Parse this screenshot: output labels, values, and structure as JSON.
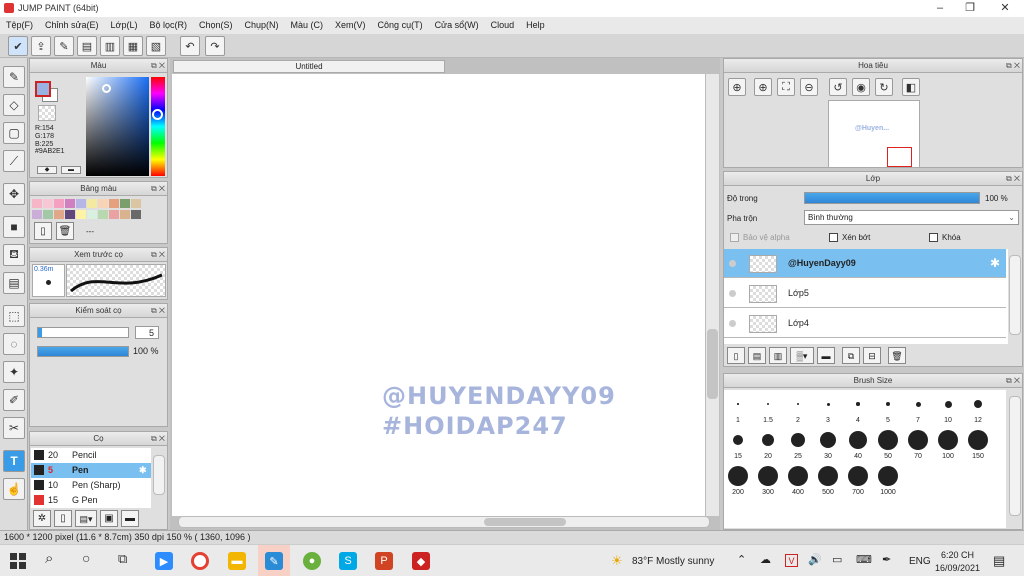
{
  "window": {
    "title": "JUMP PAINT (64bit)",
    "controls": [
      "–",
      "❐",
      "✕"
    ]
  },
  "menu": [
    "Tệp(F)",
    "Chỉnh sửa(E)",
    "Lớp(L)",
    "Bộ lọc(R)",
    "Chọn(S)",
    "Chụp(N)",
    "Màu (C)",
    "Xem(V)",
    "Công cụ(T)",
    "Cửa sổ(W)",
    "Cloud",
    "Help"
  ],
  "color_panel": {
    "title": "Màu",
    "r": "R:154",
    "g": "G:178",
    "b": "B:225",
    "hex": "#9AB2E1",
    "current_color": "#9ab2e1"
  },
  "palette_panel": {
    "title": "Bảng màu",
    "dash": "---",
    "swatches": [
      "#f6b6c8",
      "#f7c7d6",
      "#f5a0c0",
      "#d07fc0",
      "#b5b5e6",
      "#f4e9a0",
      "#f7d4b7",
      "#e5a07d",
      "#7a9f6d",
      "#dbc6a3",
      "#caaed8",
      "#a3c8a8",
      "#e0a888",
      "#61477a",
      "#fff3a6",
      "#d9efe0",
      "#b8d9b0",
      "#e9a1a1",
      "#d9b28e",
      "#6a6a6a"
    ]
  },
  "brush_preview": {
    "title": "Xem trước cọ",
    "size": "0.36m"
  },
  "brush_control": {
    "title": "Kiểm soát cọ",
    "size_value": "5",
    "opacity_value": "100 %"
  },
  "brush_list": {
    "title": "Cọ",
    "items": [
      {
        "size": "20",
        "name": "Pencil",
        "color": "#222222",
        "selected": false
      },
      {
        "size": "5",
        "name": "Pen",
        "color": "#222222",
        "selected": true
      },
      {
        "size": "10",
        "name": "Pen (Sharp)",
        "color": "#222222",
        "selected": false
      },
      {
        "size": "15",
        "name": "G Pen",
        "color": "#e23232",
        "selected": false
      }
    ]
  },
  "canvas": {
    "tab_title": "Untitled",
    "watermark_line1": "@HUYENDAYY09",
    "watermark_line2": "#HOIDAP247"
  },
  "navigator": {
    "title": "Hoa tiêu",
    "thumb_text": "@Huyen..."
  },
  "layer_panel": {
    "title": "Lớp",
    "opacity_label": "Độ trong",
    "opacity_value": "100 %",
    "opacity_fraction": 1.0,
    "blend_label": "Pha trộn",
    "blend_value": "Bình thường",
    "protect_alpha": "Bảo vệ alpha",
    "clipping": "Xén bớt",
    "lock": "Khóa",
    "layers": [
      {
        "name": "@HuyenDayy09",
        "selected": true
      },
      {
        "name": "Lớp5",
        "selected": false
      },
      {
        "name": "Lớp4",
        "selected": false
      }
    ]
  },
  "brush_size_panel": {
    "title": "Brush Size",
    "sizes": [
      "1",
      "1.5",
      "2",
      "3",
      "4",
      "5",
      "7",
      "10",
      "12",
      "15",
      "20",
      "25",
      "30",
      "40",
      "50",
      "70",
      "100",
      "150",
      "200",
      "300",
      "400",
      "500",
      "700",
      "1000"
    ]
  },
  "status": {
    "text": "1600 * 1200 pixel  (11.6 * 8.7cm)  350 dpi  150 %  ( 1360, 1096 )"
  },
  "taskbar": {
    "weather": "83°F  Mostly sunny",
    "lang": "ENG",
    "time": "6:20 CH",
    "date": "16/09/2021"
  }
}
